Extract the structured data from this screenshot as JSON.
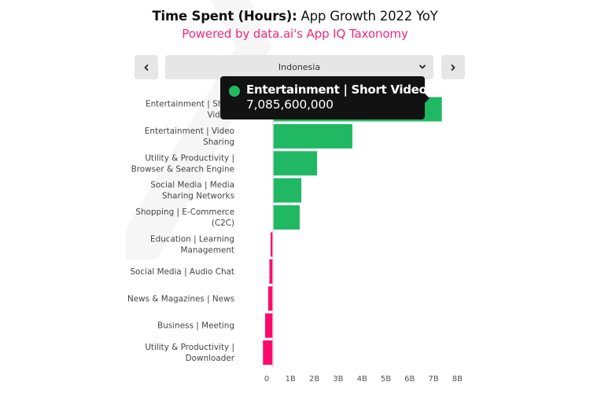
{
  "header": {
    "title_bold": "Time Spent (Hours):",
    "title_rest": " App Growth 2022 YoY",
    "subtitle": "Powered by data.ai's App IQ Taxonomy"
  },
  "selector": {
    "prev_icon": "chevron-left-icon",
    "next_icon": "chevron-right-icon",
    "selected_country": "Indonesia",
    "dropdown_icon": "chevron-down-icon"
  },
  "tooltip": {
    "category": "Entertainment | Short Videos",
    "value": "7,085,600,000"
  },
  "colors": {
    "positive": "#21b864",
    "negative": "#ff0a6c",
    "accent": "#f0287d",
    "tooltip_bg": "#121212"
  },
  "chart_data": {
    "type": "bar",
    "orientation": "horizontal",
    "title": "Time Spent (Hours): App Growth 2022 YoY",
    "subtitle": "Powered by data.ai's App IQ Taxonomy",
    "xlabel": "",
    "ylabel": "",
    "xlim": [
      -0.5,
      8
    ],
    "grid": false,
    "x_ticks": [
      "0",
      "1B",
      "2B",
      "3B",
      "4B",
      "5B",
      "6B",
      "7B",
      "8B"
    ],
    "x_tick_values": [
      0,
      1,
      2,
      3,
      4,
      5,
      6,
      7,
      8
    ],
    "categories": [
      [
        "Entertainment | Short",
        "Videos"
      ],
      [
        "Entertainment | Video",
        "Sharing"
      ],
      [
        "Utility & Productivity |",
        "Browser & Search Engine"
      ],
      [
        "Social Media | Media",
        "Sharing Networks"
      ],
      [
        "Shopping | E-Commerce",
        "(C2C)"
      ],
      [
        "Education | Learning",
        "Management"
      ],
      [
        "Social Media | Audio Chat"
      ],
      [
        "News & Magazines | News"
      ],
      [
        "Business | Meeting"
      ],
      [
        "Utility & Productivity |",
        "Downloader"
      ]
    ],
    "values": [
      7.0856,
      3.33,
      1.85,
      1.19,
      1.12,
      -0.1,
      -0.15,
      -0.2,
      -0.33,
      -0.42
    ],
    "units": "billion hours"
  }
}
